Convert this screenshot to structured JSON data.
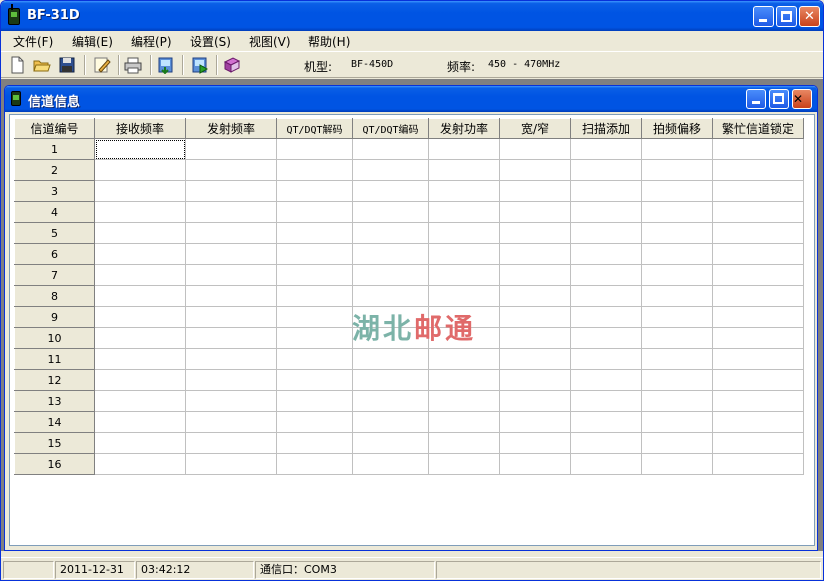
{
  "window": {
    "title": "BF-31D",
    "menu": [
      "文件(F)",
      "编辑(E)",
      "编程(P)",
      "设置(S)",
      "视图(V)",
      "帮助(H)"
    ]
  },
  "toolbar": {
    "model_label": "机型:",
    "model_value": "BF-450D",
    "freq_label": "频率:",
    "freq_value": "450 - 470MHz",
    "icons": [
      "new-file-icon",
      "open-folder-icon",
      "save-icon",
      "edit-icon",
      "print-icon",
      "read-radio-icon",
      "write-radio-icon",
      "book-icon"
    ]
  },
  "child_window": {
    "title": "信道信息"
  },
  "grid": {
    "columns": [
      "信道编号",
      "接收频率",
      "发射频率",
      "QT/DQT解码",
      "QT/DQT编码",
      "发射功率",
      "宽/窄",
      "扫描添加",
      "拍频偏移",
      "繁忙信道锁定"
    ],
    "rows": [
      "1",
      "2",
      "3",
      "4",
      "5",
      "6",
      "7",
      "8",
      "9",
      "10",
      "11",
      "12",
      "13",
      "14",
      "15",
      "16"
    ]
  },
  "watermark": {
    "part_a": "湖北",
    "part_b": "邮通"
  },
  "statusbar": {
    "date": "2011-12-31",
    "time": "03:42:12",
    "port": "通信口：COM3"
  },
  "colors": {
    "title_blue": "#0054e3",
    "close_red": "#c9421b",
    "face": "#ece9d8",
    "mdi_bg": "#808080"
  }
}
